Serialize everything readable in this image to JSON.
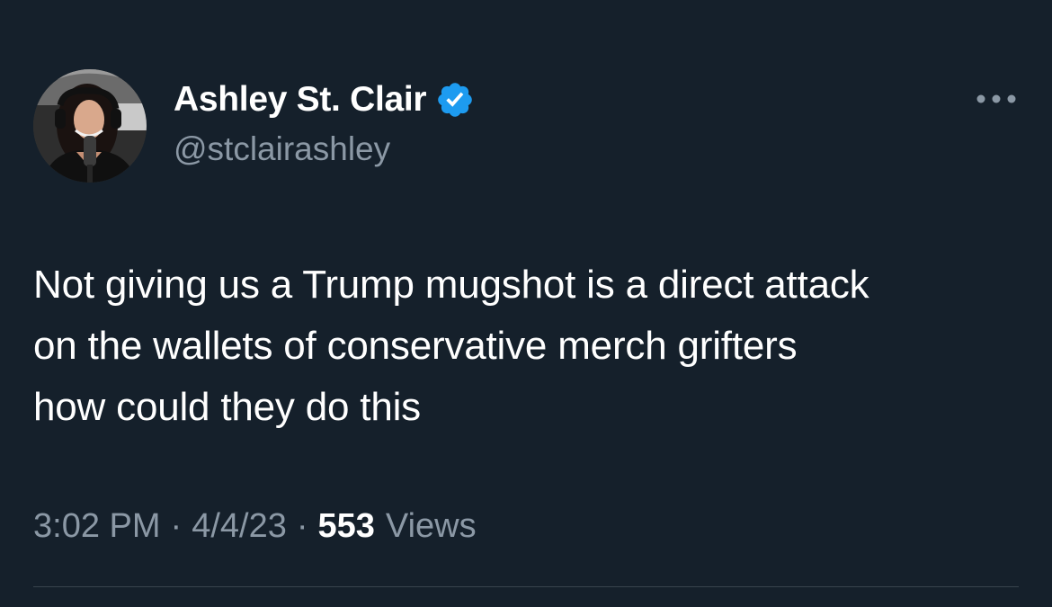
{
  "author": {
    "display_name": "Ashley St. Clair",
    "handle": "@stclairashley",
    "verified": true
  },
  "tweet": {
    "text": "Not giving us a Trump mugshot is a direct attack\non the wallets of conservative merch grifters\nhow could they do this",
    "time": "3:02 PM",
    "date": "4/4/23",
    "separator": "·",
    "view_count": "553",
    "views_label": "Views"
  },
  "icons": {
    "verified": "verified-badge-icon",
    "more": "more-horizontal-icon"
  },
  "colors": {
    "background": "#15202b",
    "primary_text": "#ffffff",
    "secondary_text": "#8b98a5",
    "verified_blue": "#1d9bf0",
    "divider": "#38444d"
  }
}
